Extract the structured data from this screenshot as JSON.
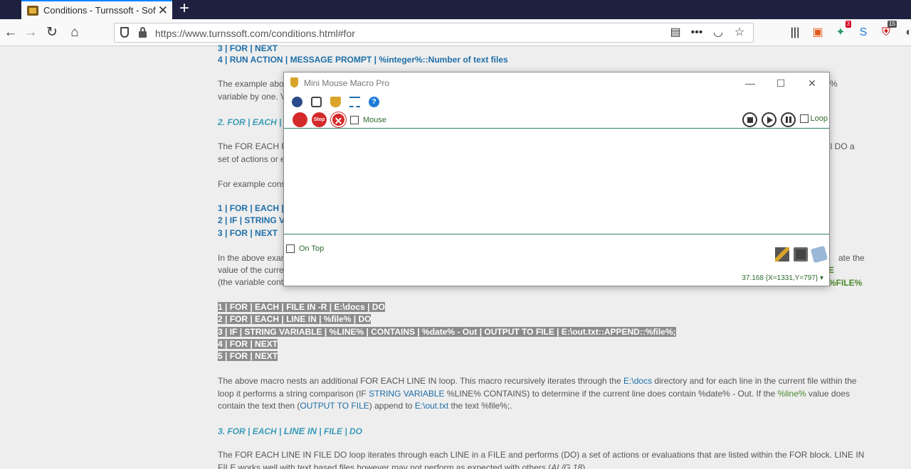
{
  "browser": {
    "tab_title": "Conditions - Turnssoft - Software",
    "tab_close": "✕",
    "new_tab": "+",
    "url": "https://www.turnssoft.com/conditions.html#for",
    "badges": {
      "b1": "3",
      "b2": "15"
    }
  },
  "page": {
    "top_lines": [
      "3 | FOR | NEXT",
      "4 | RUN ACTION | MESSAGE PROMPT | %integer%::Number of text files"
    ],
    "para1_a": "The example abo",
    "para1_b": "%",
    "para1_c": "variable by one.  V",
    "heading2": "2. FOR | EACH | F",
    "para2_a": "The FOR EACH F",
    "para2_b": "ll DO a",
    "para2_c": "set of actions or e",
    "para3": "For example cons",
    "code2": [
      "1 | FOR | EACH | FI",
      "2 | IF | STRING VA",
      "3 | FOR | NEXT"
    ],
    "para4_a": "In the above exam",
    "para4_b": "ate the",
    "para4_c": "value of the curren",
    "para4_d": "E %FILE%",
    "para4_e": "(the variable conta",
    "code3": [
      "1 | FOR | EACH | FILE IN -R | E:\\docs | DO",
      "2 | FOR | EACH | LINE IN | %file% | DO",
      "3 | IF | STRING VARIABLE | %LINE% | CONTAINS | %date% - Out | OUTPUT TO FILE | E:\\out.txt::APPEND::%file%;",
      "4 | FOR | NEXT",
      "5 | FOR | NEXT"
    ],
    "para5": {
      "t1": "The above macro nests an additional FOR EACH LINE IN loop.  This macro recursively iterates through the ",
      "l1": "E:\\docs",
      "t2": " directory and for each line in the current file within the loop it performs a string comparison (IF ",
      "l2": "STRING VARIABLE",
      "t3": " %LINE% CONTAINS) to determine if the current line does contain %date% - Out.  If the ",
      "g1": "%line%",
      "t4": " value does contain the text then (",
      "l3": "OUTPUT TO FILE",
      "t5": ") append to ",
      "l4": "E:\\out.txt",
      "t6": " the text %file%;."
    },
    "heading3a": "3. FOR | EACH | ",
    "heading3b": "LINE IN",
    "heading3c": "  | FILE | DO",
    "para6": "The FOR EACH LINE IN FILE DO loop iterates through each LINE in a FILE and performs (DO) a set of actions or evaluations that are listed within the FOR block.  LINE IN FILE works well with text based files however may not perform as expected with others (",
    "para6_italic": "AL/G.18",
    "para6_end": ")"
  },
  "mmm": {
    "title": "Mini Mouse Macro Pro",
    "stop_label": "Stop",
    "mouse_label": "Mouse",
    "loop_label": "Loop",
    "ontop_label": "On Top",
    "status": "37.168  {X=1331,Y=797}  ▾",
    "minimize": "—",
    "maximize": "☐",
    "close": "✕"
  }
}
